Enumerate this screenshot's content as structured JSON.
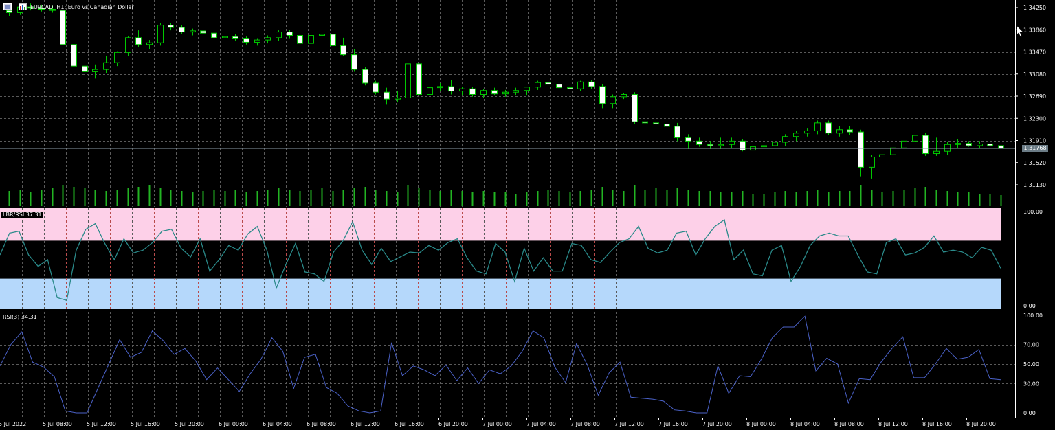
{
  "header": {
    "title": "EURCAD, H1: Euro vs Canadian Dollar",
    "menu_icon": "window-menu-icon",
    "chart_icon": "chart-icon"
  },
  "colors": {
    "background": "#000000",
    "bull_fill": "#000000",
    "bear_fill": "#ffffff",
    "wick": "#00c800",
    "volume": "#22b422",
    "grid": "#5a5a5a",
    "bid_line": "#8a9aa6",
    "lbr_line": "#2a8a8a",
    "rsi_line": "#4b62c9",
    "overbought_zone": "#fdd0e8",
    "oversold_zone": "#b5d8fb",
    "date_separator": "#d04848"
  },
  "price_axis": {
    "ticks": [
      "1.34250",
      "1.33860",
      "1.33470",
      "1.33080",
      "1.32690",
      "1.32300",
      "1.31910",
      "1.31520",
      "1.31130"
    ],
    "current_price": "1.31768"
  },
  "lbr_panel": {
    "label": "LBR/RSI 37.31",
    "ticks": [
      "100.00",
      "0.00"
    ]
  },
  "rsi_panel": {
    "label": "RSI(3) 34.31",
    "ticks": [
      "100.00",
      "70.00",
      "50.00",
      "30.00",
      "0.00"
    ]
  },
  "time_axis": {
    "labels": [
      "5 Jul 2022",
      "5 Jul 08:00",
      "5 Jul 12:00",
      "5 Jul 16:00",
      "5 Jul 20:00",
      "6 Jul 00:00",
      "6 Jul 04:00",
      "6 Jul 08:00",
      "6 Jul 12:00",
      "6 Jul 16:00",
      "6 Jul 20:00",
      "7 Jul 00:00",
      "7 Jul 04:00",
      "7 Jul 08:00",
      "7 Jul 12:00",
      "7 Jul 16:00",
      "7 Jul 20:00",
      "8 Jul 00:00",
      "8 Jul 04:00",
      "8 Jul 08:00",
      "8 Jul 12:00",
      "8 Jul 16:00",
      "8 Jul 20:00"
    ]
  },
  "chart_data": {
    "type": "candlestick",
    "symbol": "EURCAD",
    "timeframe": "H1",
    "ohlc": [
      [
        1.342,
        1.3428,
        1.341,
        1.3416
      ],
      [
        1.3416,
        1.343,
        1.3412,
        1.3426
      ],
      [
        1.3426,
        1.3432,
        1.342,
        1.3424
      ],
      [
        1.3424,
        1.343,
        1.3418,
        1.3422
      ],
      [
        1.3422,
        1.3428,
        1.3416,
        1.342
      ],
      [
        1.342,
        1.3424,
        1.3355,
        1.336
      ],
      [
        1.336,
        1.3365,
        1.3318,
        1.3322
      ],
      [
        1.3322,
        1.333,
        1.3298,
        1.3312
      ],
      [
        1.3312,
        1.3325,
        1.33,
        1.3316
      ],
      [
        1.3316,
        1.334,
        1.331,
        1.3328
      ],
      [
        1.3328,
        1.3348,
        1.3322,
        1.3346
      ],
      [
        1.3346,
        1.3375,
        1.334,
        1.3372
      ],
      [
        1.3372,
        1.3385,
        1.3355,
        1.336
      ],
      [
        1.336,
        1.3368,
        1.3352,
        1.3363
      ],
      [
        1.3363,
        1.3398,
        1.3358,
        1.3394
      ],
      [
        1.3394,
        1.3398,
        1.3385,
        1.339
      ],
      [
        1.339,
        1.3394,
        1.3378,
        1.3382
      ],
      [
        1.3382,
        1.3388,
        1.3376,
        1.3384
      ],
      [
        1.3384,
        1.339,
        1.3376,
        1.338
      ],
      [
        1.338,
        1.3384,
        1.3368,
        1.3372
      ],
      [
        1.3372,
        1.3378,
        1.3366,
        1.3374
      ],
      [
        1.3374,
        1.3378,
        1.3366,
        1.337
      ],
      [
        1.337,
        1.3374,
        1.336,
        1.3364
      ],
      [
        1.3364,
        1.337,
        1.3358,
        1.3368
      ],
      [
        1.3368,
        1.3376,
        1.3362,
        1.3372
      ],
      [
        1.3372,
        1.3385,
        1.3366,
        1.3382
      ],
      [
        1.3382,
        1.3386,
        1.337,
        1.3376
      ],
      [
        1.3376,
        1.338,
        1.336,
        1.3362
      ],
      [
        1.3362,
        1.3382,
        1.3356,
        1.3376
      ],
      [
        1.3376,
        1.3388,
        1.337,
        1.3378
      ],
      [
        1.3378,
        1.3382,
        1.3354,
        1.3358
      ],
      [
        1.3358,
        1.3372,
        1.334,
        1.3342
      ],
      [
        1.3342,
        1.3352,
        1.3312,
        1.3316
      ],
      [
        1.3316,
        1.332,
        1.3288,
        1.3292
      ],
      [
        1.3292,
        1.3296,
        1.3272,
        1.3276
      ],
      [
        1.3276,
        1.3284,
        1.3254,
        1.3264
      ],
      [
        1.3264,
        1.3278,
        1.3258,
        1.3266
      ],
      [
        1.3266,
        1.3332,
        1.3258,
        1.3326
      ],
      [
        1.3326,
        1.333,
        1.3268,
        1.3272
      ],
      [
        1.3272,
        1.3288,
        1.3266,
        1.3284
      ],
      [
        1.3284,
        1.3292,
        1.3278,
        1.3286
      ],
      [
        1.3286,
        1.3298,
        1.3272,
        1.3278
      ],
      [
        1.3278,
        1.3286,
        1.327,
        1.3282
      ],
      [
        1.3282,
        1.3286,
        1.3268,
        1.3272
      ],
      [
        1.3272,
        1.3282,
        1.3266,
        1.3279
      ],
      [
        1.3279,
        1.3284,
        1.327,
        1.3273
      ],
      [
        1.3273,
        1.328,
        1.3268,
        1.3276
      ],
      [
        1.3276,
        1.3284,
        1.327,
        1.3279
      ],
      [
        1.3279,
        1.3286,
        1.327,
        1.3285
      ],
      [
        1.3285,
        1.3296,
        1.328,
        1.3293
      ],
      [
        1.3293,
        1.3298,
        1.3284,
        1.329
      ],
      [
        1.329,
        1.3294,
        1.328,
        1.3284
      ],
      [
        1.3284,
        1.329,
        1.3276,
        1.3282
      ],
      [
        1.3282,
        1.3296,
        1.3278,
        1.3294
      ],
      [
        1.3294,
        1.3298,
        1.3282,
        1.3286
      ],
      [
        1.3286,
        1.329,
        1.3248,
        1.3256
      ],
      [
        1.3256,
        1.3272,
        1.3248,
        1.3268
      ],
      [
        1.3268,
        1.3274,
        1.3264,
        1.3272
      ],
      [
        1.3272,
        1.3276,
        1.322,
        1.3224
      ],
      [
        1.3224,
        1.323,
        1.3218,
        1.3222
      ],
      [
        1.3222,
        1.324,
        1.3216,
        1.322
      ],
      [
        1.322,
        1.3236,
        1.3212,
        1.3216
      ],
      [
        1.3216,
        1.3222,
        1.319,
        1.3196
      ],
      [
        1.3196,
        1.3202,
        1.3176,
        1.319
      ],
      [
        1.319,
        1.3196,
        1.318,
        1.3184
      ],
      [
        1.3184,
        1.319,
        1.3176,
        1.3182
      ],
      [
        1.3182,
        1.3196,
        1.3176,
        1.3184
      ],
      [
        1.3184,
        1.3196,
        1.3178,
        1.319
      ],
      [
        1.319,
        1.3194,
        1.3172,
        1.3174
      ],
      [
        1.3174,
        1.3184,
        1.3168,
        1.318
      ],
      [
        1.318,
        1.3186,
        1.3174,
        1.3182
      ],
      [
        1.3182,
        1.3192,
        1.3178,
        1.3188
      ],
      [
        1.3188,
        1.3202,
        1.3182,
        1.3198
      ],
      [
        1.3198,
        1.3208,
        1.319,
        1.3204
      ],
      [
        1.3204,
        1.3212,
        1.3198,
        1.3208
      ],
      [
        1.3208,
        1.3226,
        1.3202,
        1.3222
      ],
      [
        1.3222,
        1.3226,
        1.32,
        1.3204
      ],
      [
        1.3204,
        1.3216,
        1.3198,
        1.321
      ],
      [
        1.321,
        1.3216,
        1.32,
        1.3206
      ],
      [
        1.3206,
        1.321,
        1.3128,
        1.3144
      ],
      [
        1.3144,
        1.3166,
        1.3124,
        1.3162
      ],
      [
        1.3162,
        1.3172,
        1.3156,
        1.3166
      ],
      [
        1.3166,
        1.3182,
        1.3162,
        1.3178
      ],
      [
        1.3178,
        1.3196,
        1.3172,
        1.319
      ],
      [
        1.319,
        1.321,
        1.3186,
        1.32
      ],
      [
        1.32,
        1.3204,
        1.3164,
        1.3168
      ],
      [
        1.3168,
        1.3196,
        1.3164,
        1.3172
      ],
      [
        1.3172,
        1.3188,
        1.3166,
        1.3184
      ],
      [
        1.3184,
        1.3194,
        1.3178,
        1.3186
      ],
      [
        1.3186,
        1.319,
        1.318,
        1.3182
      ],
      [
        1.3182,
        1.319,
        1.3178,
        1.3185
      ],
      [
        1.3185,
        1.319,
        1.3176,
        1.3182
      ],
      [
        1.3182,
        1.3186,
        1.3174,
        1.3177
      ]
    ],
    "volume": [
      22,
      24,
      20,
      24,
      26,
      30,
      28,
      26,
      24,
      22,
      24,
      26,
      28,
      30,
      26,
      24,
      22,
      20,
      22,
      24,
      22,
      24,
      20,
      22,
      24,
      26,
      24,
      22,
      24,
      26,
      22,
      24,
      26,
      28,
      24,
      22,
      20,
      30,
      26,
      24,
      22,
      24,
      22,
      20,
      22,
      20,
      20,
      18,
      20,
      22,
      24,
      22,
      20,
      22,
      24,
      28,
      24,
      22,
      30,
      24,
      26,
      24,
      26,
      24,
      22,
      22,
      20,
      20,
      22,
      18,
      18,
      20,
      22,
      20,
      22,
      24,
      20,
      22,
      22,
      30,
      24,
      20,
      22,
      24,
      26,
      28,
      24,
      22,
      20,
      20,
      18,
      18,
      16
    ],
    "lbr_rsi": [
      55,
      78,
      80,
      55,
      43,
      50,
      10,
      7,
      60,
      82,
      88,
      67,
      50,
      72,
      57,
      60,
      68,
      80,
      82,
      62,
      53,
      72,
      38,
      50,
      65,
      60,
      77,
      85,
      60,
      20,
      45,
      67,
      37,
      35,
      27,
      58,
      70,
      90,
      60,
      45,
      62,
      48,
      53,
      58,
      57,
      65,
      60,
      68,
      72,
      52,
      38,
      35,
      67,
      58,
      27,
      62,
      38,
      52,
      38,
      38,
      67,
      65,
      50,
      47,
      58,
      68,
      72,
      85,
      62,
      57,
      60,
      78,
      80,
      55,
      72,
      85,
      92,
      50,
      60,
      35,
      33,
      60,
      65,
      27,
      43,
      65,
      75,
      78,
      75,
      75,
      55,
      37,
      35,
      68,
      72,
      55,
      57,
      63,
      75,
      58,
      60,
      58,
      52,
      63,
      60,
      41
    ]
  },
  "rsi_series": [
    48,
    70,
    83,
    52,
    47,
    37,
    2,
    0,
    0,
    25,
    50,
    75,
    57,
    62,
    84,
    74,
    60,
    66,
    53,
    34,
    46,
    34,
    22,
    40,
    55,
    77,
    63,
    25,
    57,
    60,
    26,
    20,
    7,
    2,
    0,
    2,
    72,
    38,
    48,
    44,
    38,
    49,
    33,
    46,
    30,
    44,
    40,
    48,
    63,
    84,
    77,
    47,
    31,
    71,
    49,
    18,
    41,
    52,
    16,
    15,
    14,
    12,
    3,
    2,
    0,
    0,
    48,
    20,
    38,
    37,
    55,
    77,
    88,
    88,
    99,
    43,
    56,
    50,
    10,
    35,
    34,
    52,
    66,
    78,
    36,
    36,
    50,
    66,
    55,
    57,
    65,
    35,
    34
  ]
}
